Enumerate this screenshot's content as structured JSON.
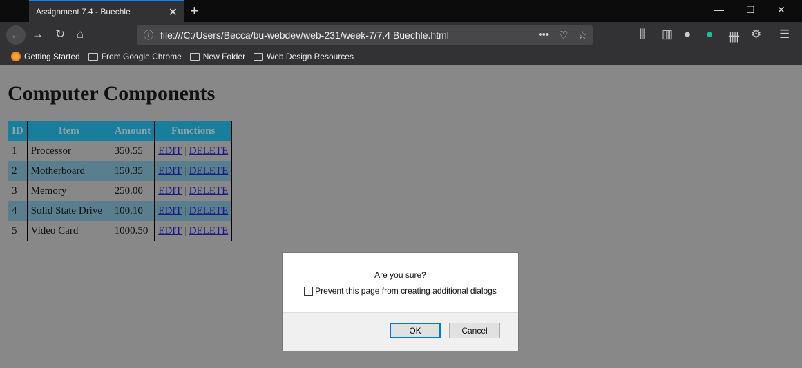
{
  "browser": {
    "tab_title": "Assignment 7.4 - Buechle",
    "url": "file:///C:/Users/Becca/bu-webdev/web-231/week-7/7.4 Buechle.html",
    "bookmarks": [
      "Getting Started",
      "From Google Chrome",
      "New Folder",
      "Web Design Resources"
    ]
  },
  "page": {
    "title": "Computer Components",
    "table": {
      "headers": [
        "ID",
        "Item",
        "Amount",
        "Functions"
      ],
      "rows": [
        {
          "id": "1",
          "item": "Processor",
          "amount": "350.55"
        },
        {
          "id": "2",
          "item": "Motherboard",
          "amount": "150.35"
        },
        {
          "id": "3",
          "item": "Memory",
          "amount": "250.00"
        },
        {
          "id": "4",
          "item": "Solid State Drive",
          "amount": "100.10"
        },
        {
          "id": "5",
          "item": "Video Card",
          "amount": "1000.50"
        }
      ],
      "edit_label": "EDIT",
      "separator": "|",
      "delete_label": "DELETE"
    }
  },
  "dialog": {
    "message": "Are you sure?",
    "checkbox_label": "Prevent this page from creating additional dialogs",
    "checkbox_checked": false,
    "ok_label": "OK",
    "cancel_label": "Cancel"
  },
  "colors": {
    "header_bg": "#187e9c",
    "alt_row": "#597f8f",
    "accent": "#0a84ff"
  }
}
